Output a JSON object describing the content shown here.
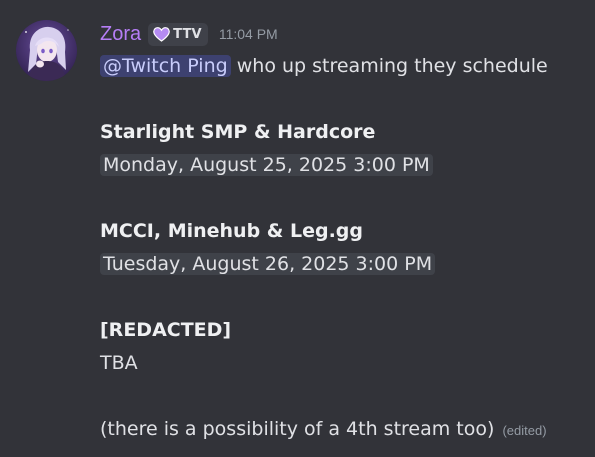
{
  "message": {
    "author": {
      "username": "Zora",
      "tag": "TTV",
      "tag_icon": "purple-heart-icon",
      "username_color": "#b67ef6"
    },
    "timestamp": "11:04 PM",
    "mention": "@Twitch Ping",
    "intro": "who up streaming they schedule",
    "streams": [
      {
        "title": "Starlight SMP & Hardcore",
        "time": "Monday, August 25, 2025 3:00 PM"
      },
      {
        "title": "MCCI, Minehub & Leg.gg",
        "time": "Tuesday, August 26, 2025 3:00 PM"
      },
      {
        "title": "[REDACTED]",
        "time": "TBA"
      }
    ],
    "footer": "(there is a possibility of a 4th stream too)",
    "edited_label": "(edited)"
  },
  "colors": {
    "background": "#323339",
    "mention_bg": "rgba(88, 101, 242, 0.3)",
    "mention_text": "#c9cdfb",
    "timestamp_chip": "#3f4249"
  }
}
